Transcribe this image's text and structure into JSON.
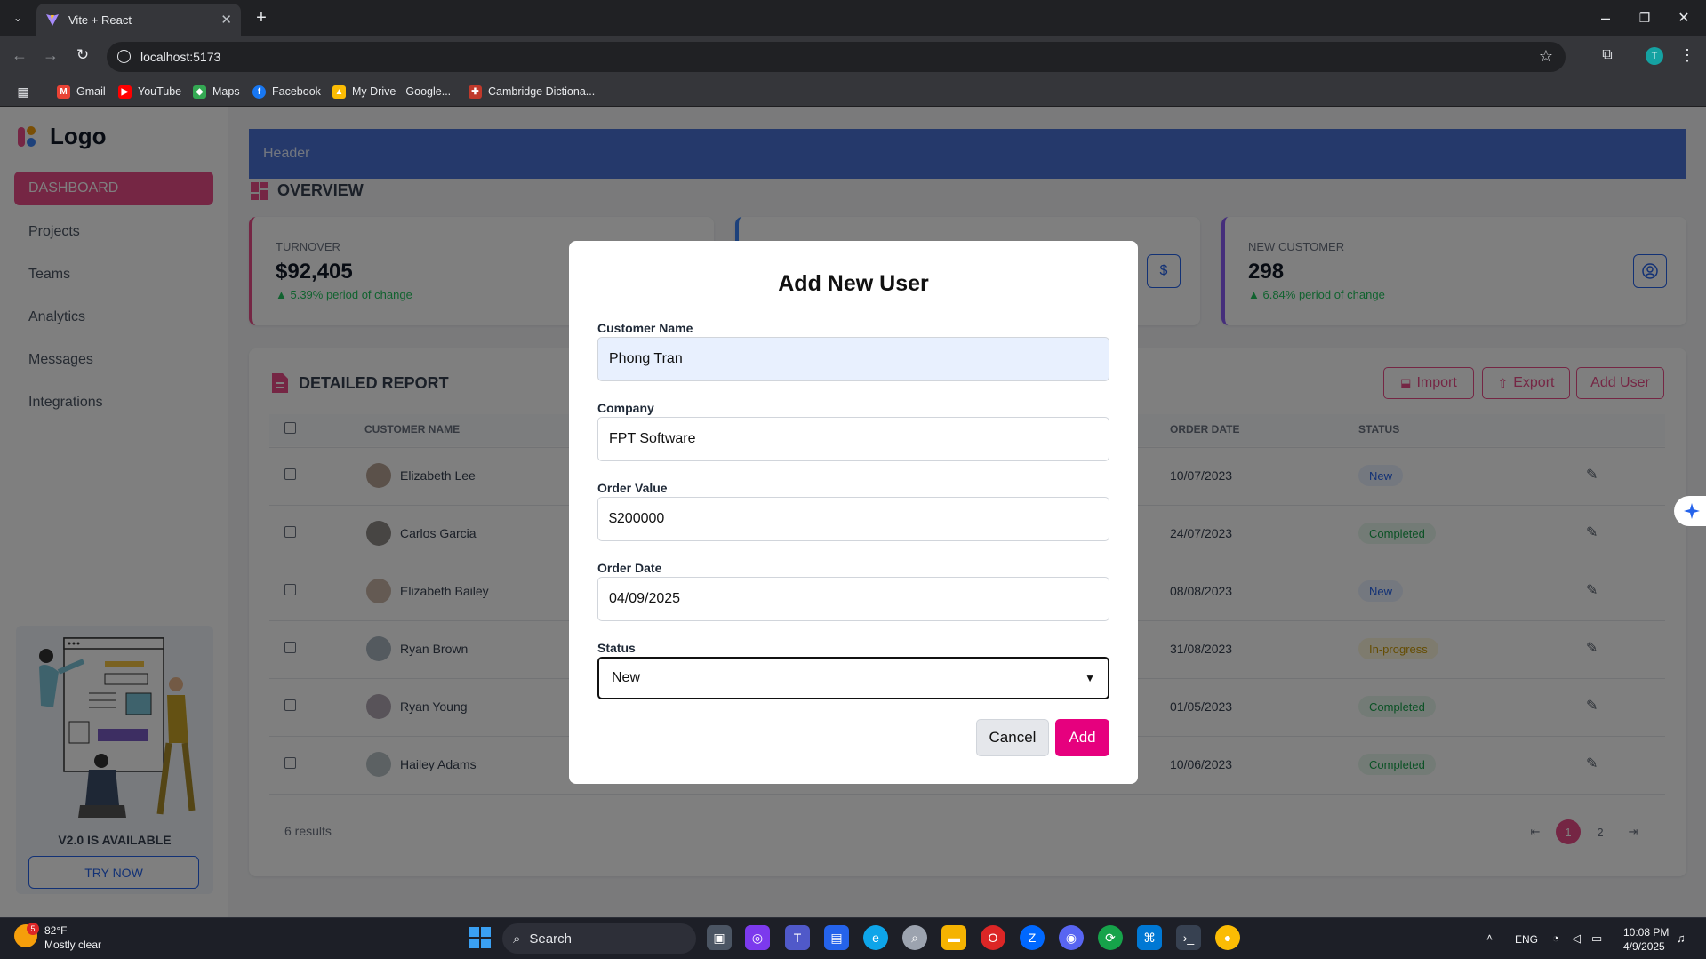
{
  "browser": {
    "tab_title": "Vite + React",
    "url": "localhost:5173",
    "profile_initial": "T",
    "bookmarks": [
      "Gmail",
      "YouTube",
      "Maps",
      "Facebook",
      "My Drive - Google...",
      "Cambridge Dictiona..."
    ]
  },
  "sidebar": {
    "logo_text": "Logo",
    "nav": [
      "DASHBOARD",
      "Projects",
      "Teams",
      "Analytics",
      "Messages",
      "Integrations"
    ],
    "promo_title": "V2.0 IS AVAILABLE",
    "promo_button": "TRY NOW"
  },
  "header": {
    "title": "Header"
  },
  "overview": {
    "title": "OVERVIEW",
    "cards": [
      {
        "label": "TURNOVER",
        "value": "$92,405",
        "change": "▲ 5.39% period of change"
      },
      {
        "label": "NEW CUSTOMER",
        "value": "298",
        "change": "▲ 6.84% period of change"
      }
    ],
    "middle_card_icon": "dollar-icon",
    "right_card_icon": "user-icon"
  },
  "report": {
    "title": "DETAILED REPORT",
    "buttons": {
      "import": "Import",
      "export": "Export",
      "add": "Add User"
    },
    "columns": {
      "customer": "CUSTOMER NAME",
      "order_date": "ORDER DATE",
      "status": "STATUS"
    },
    "rows": [
      {
        "name": "Elizabeth Lee",
        "date": "10/07/2023",
        "status": "New"
      },
      {
        "name": "Carlos Garcia",
        "date": "24/07/2023",
        "status": "Completed"
      },
      {
        "name": "Elizabeth Bailey",
        "date": "08/08/2023",
        "status": "New"
      },
      {
        "name": "Ryan Brown",
        "date": "31/08/2023",
        "status": "In-progress"
      },
      {
        "name": "Ryan Young",
        "date": "01/05/2023",
        "status": "Completed"
      },
      {
        "name": "Hailey Adams",
        "date": "10/06/2023",
        "status": "Completed"
      }
    ],
    "results": "6 results",
    "pages": [
      "1",
      "2"
    ],
    "current_page": "1"
  },
  "modal": {
    "title": "Add New User",
    "fields": {
      "customer_name": {
        "label": "Customer Name",
        "value": "Phong Tran"
      },
      "company": {
        "label": "Company",
        "value": "FPT Software"
      },
      "order_value": {
        "label": "Order Value",
        "value": "$200000"
      },
      "order_date": {
        "label": "Order Date",
        "value": "04/09/2025"
      },
      "status": {
        "label": "Status",
        "value": "New"
      }
    },
    "cancel": "Cancel",
    "add": "Add"
  },
  "taskbar": {
    "weather_temp": "82°F",
    "weather_desc": "Mostly clear",
    "weather_badge": "5",
    "search": "Search",
    "lang": "ENG",
    "time": "10:08 PM",
    "date": "4/9/2025"
  },
  "colors": {
    "accent": "#ea4c89",
    "add_button": "#e6007e",
    "header": "#4a73d6",
    "link_blue": "#2563eb"
  }
}
